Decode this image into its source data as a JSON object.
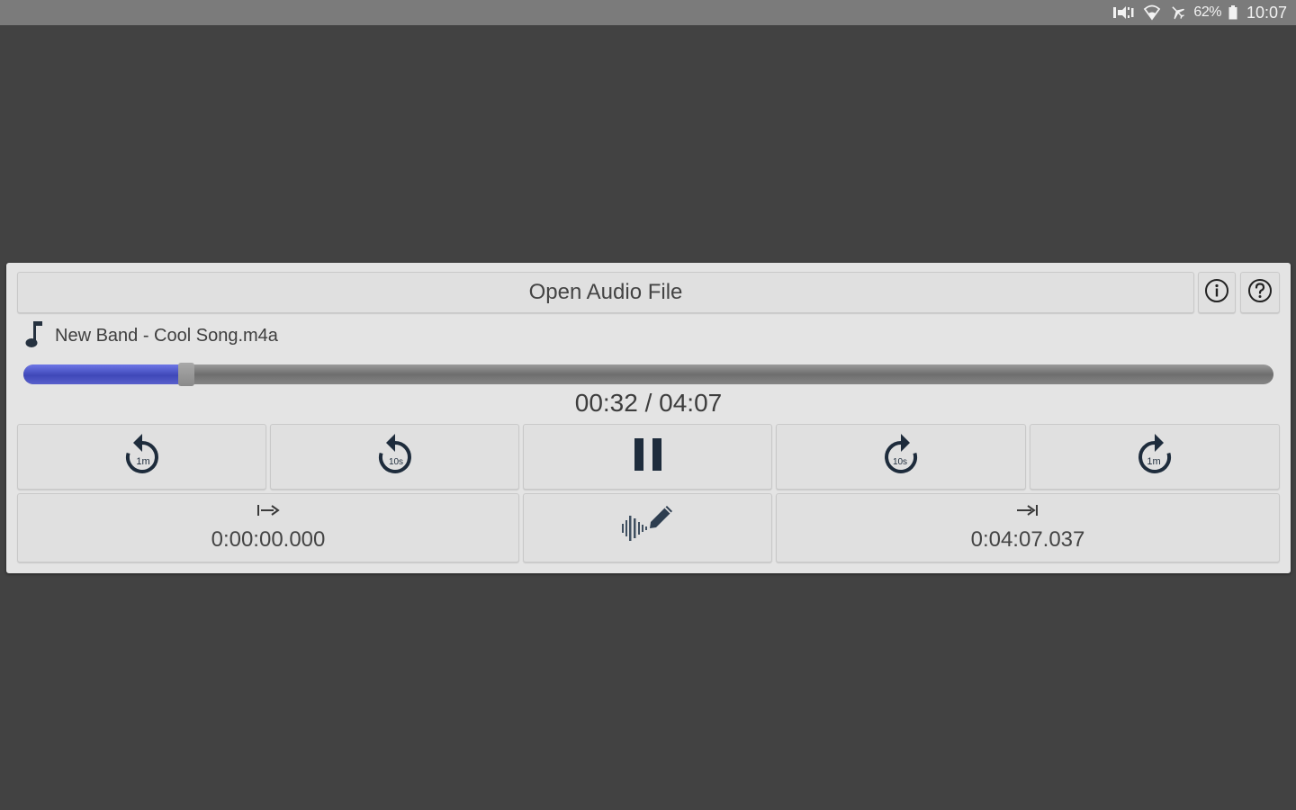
{
  "status_bar": {
    "icons": [
      "mute-vibrate-icon",
      "wifi-icon",
      "airplane-mode-icon",
      "battery-icon"
    ],
    "battery": "62%",
    "time": "10:07"
  },
  "header": {
    "open_label": "Open Audio File",
    "info_icon": "info-icon",
    "help_icon": "help-icon"
  },
  "track": {
    "file_name": "New Band - Cool Song.m4a",
    "elapsed": "00:32",
    "duration": "04:07",
    "time_text": "00:32 / 04:07",
    "progress": 0.13
  },
  "controls": [
    {
      "name": "rewind-1m-button",
      "icon": "rewind-1m-icon",
      "label": "1m"
    },
    {
      "name": "rewind-10s-button",
      "icon": "rewind-10s-icon",
      "label": "10s"
    },
    {
      "name": "pause-button",
      "icon": "pause-icon"
    },
    {
      "name": "forward-10s-button",
      "icon": "forward-10s-icon",
      "label": "10s"
    },
    {
      "name": "forward-1m-button",
      "icon": "forward-1m-icon",
      "label": "1m"
    }
  ],
  "loop": {
    "start_time": "0:00:00.000",
    "end_time": "0:04:07.037",
    "start_icon": "loop-start-icon",
    "end_icon": "loop-end-icon",
    "edit_icon": "waveform-edit-icon"
  },
  "colors": {
    "background": "#424242",
    "panel": "#e4e4e4",
    "progress": "#4a52c4",
    "icon": "#1e2c3c"
  }
}
